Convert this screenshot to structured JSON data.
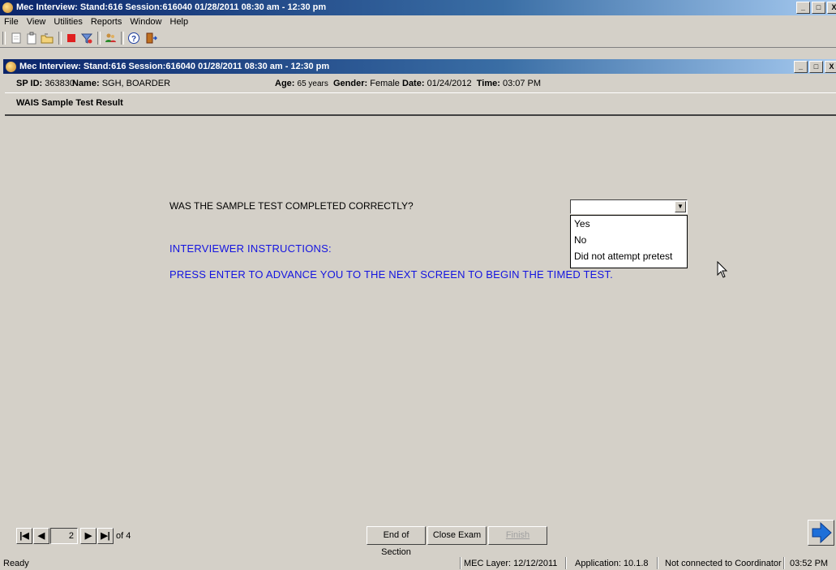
{
  "outer_window": {
    "title": "Mec Interview: Stand:616 Session:616040 01/28/2011 08:30 am - 12:30 pm",
    "controls": [
      "_",
      "□",
      "X"
    ]
  },
  "menu": [
    "File",
    "View",
    "Utilities",
    "Reports",
    "Window",
    "Help"
  ],
  "toolbar": {
    "icons": [
      "new-icon",
      "clipboard-icon",
      "open-folder-icon",
      "stop-icon",
      "filter-icon",
      "users-icon",
      "help-icon",
      "exit-door-icon"
    ]
  },
  "inner_window": {
    "title": "Mec Interview: Stand:616 Session:616040 01/28/2011 08:30 am - 12:30 pm",
    "controls": [
      "_",
      "□",
      "X"
    ]
  },
  "participant": {
    "sp_id_label": "SP ID:",
    "sp_id": "363830",
    "name_label": "Name:",
    "name": "SGH, BOARDER",
    "age_label": "Age:",
    "age": "65 years",
    "gender_label": "Gender:",
    "gender": "Female",
    "date_label": "Date:",
    "date": "01/24/2012",
    "time_label": "Time:",
    "time": "03:07 PM"
  },
  "section_title": "WAIS Sample Test Result",
  "question": {
    "text": "WAS THE SAMPLE TEST COMPLETED CORRECTLY?",
    "selected_value": "",
    "options": [
      "Yes",
      "No",
      "Did not attempt pretest"
    ]
  },
  "instructions": {
    "heading": "INTERVIEWER INSTRUCTIONS:",
    "body": "PRESS ENTER TO ADVANCE YOU TO THE NEXT SCREEN TO BEGIN THE TIMED TEST."
  },
  "navigation": {
    "page": "2",
    "of_label": "of 4"
  },
  "buttons": {
    "end_of_section": "End of Section",
    "close_exam": "Close Exam",
    "finish": "Finish"
  },
  "status": {
    "ready": "Ready",
    "mec_layer": "MEC Layer: 12/12/2011",
    "application": "Application: 10.1.8",
    "coordinator": "Not connected to Coordinator",
    "clock": "03:52 PM"
  },
  "colors": {
    "title_gradient_start": "#0a246a",
    "instruction_blue": "#1414e0",
    "next_arrow": "#1e6fd9"
  }
}
